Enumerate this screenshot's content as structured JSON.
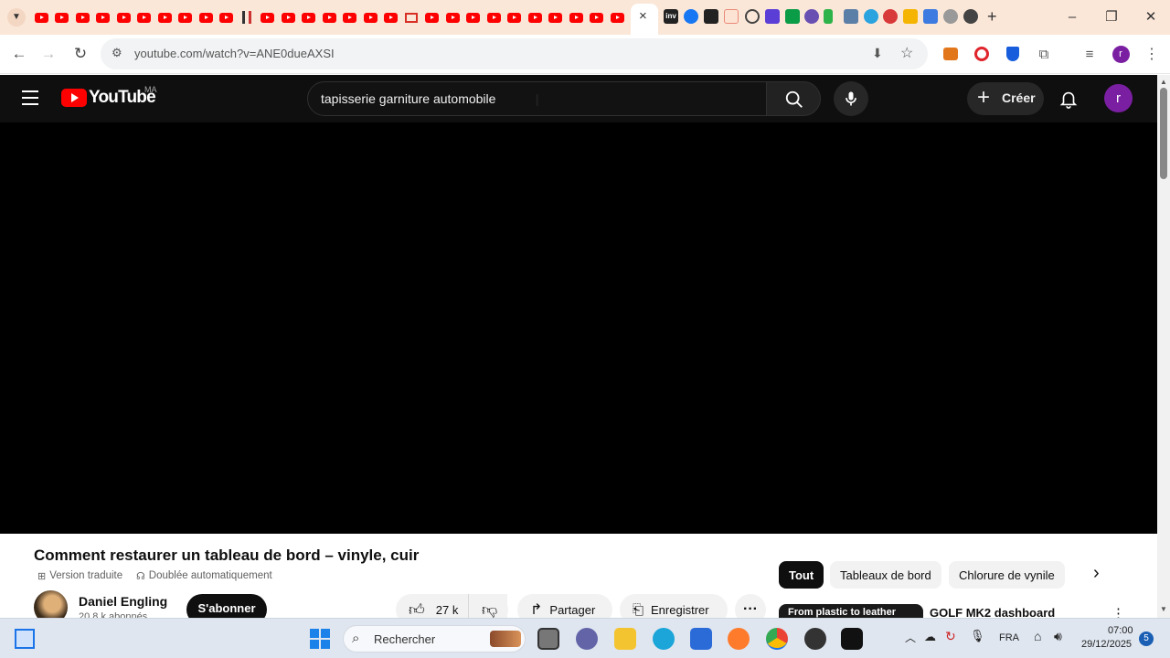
{
  "browser": {
    "url": "youtube.com/watch?v=ANE0dueAXSI",
    "tab_close_glyph": "×",
    "new_tab_glyph": "+"
  },
  "masthead": {
    "logo_text": "YouTube",
    "country_code": "MA",
    "search_value": "tapisserie garniture automobile",
    "create_label": "Créer",
    "avatar_initial": "r"
  },
  "video": {
    "title": "Comment restaurer un tableau de bord – vinyle, cuir",
    "badges": [
      "Version traduite",
      "Doublée automatiquement"
    ],
    "channel_name": "Daniel Engling",
    "subscribers": "20,8 k abonnés",
    "subscribe_label": "S'abonner",
    "likes": "27 k",
    "share_label": "Partager",
    "save_label": "Enregistrer"
  },
  "chips": [
    "Tout",
    "Tableaux de bord",
    "Chlorure de vynile"
  ],
  "recommendation": {
    "thumb_text": "From plastic to leather",
    "title": "GOLF MK2 dashboard"
  },
  "taskbar": {
    "search_placeholder": "Rechercher",
    "language": "FRA",
    "time": "07:00",
    "date": "29/12/2025",
    "notification_count": "5"
  }
}
